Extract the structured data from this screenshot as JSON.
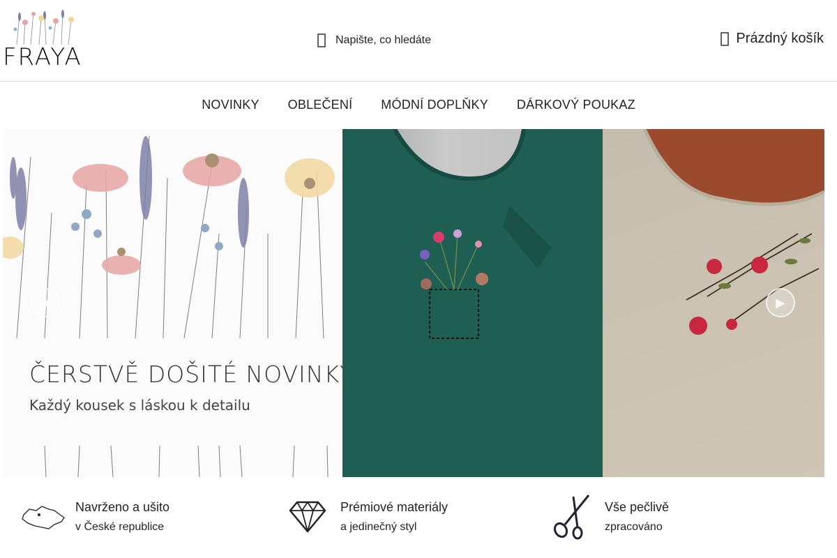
{
  "brand": {
    "logo_text": "FRAYA"
  },
  "header": {
    "search_label": "Napište, co hledáte",
    "cart_label": "Prázdný košík"
  },
  "nav": {
    "items": [
      {
        "label": "NOVINKY"
      },
      {
        "label": "OBLEČENÍ"
      },
      {
        "label": "MÓDNÍ DOPLŇKY"
      },
      {
        "label": "DÁRKOVÝ POUKAZ"
      }
    ]
  },
  "hero": {
    "title": "ČERSTVĚ DOŠITÉ NOVINKY",
    "subtitle": "Každý kousek s láskou k detailu",
    "prev_icon": "chevron-left-icon",
    "next_icon": "chevron-right-icon",
    "prev_glyph": "◀",
    "next_glyph": "▶"
  },
  "features": [
    {
      "icon": "czech-map-icon",
      "line1": "Navrženo a ušito",
      "line2": "v České republice"
    },
    {
      "icon": "diamond-icon",
      "line1": "Prémiové materiály",
      "line2": "a jedinečný styl"
    },
    {
      "icon": "scissors-icon",
      "line1": "Vše pečlivě",
      "line2": "zpracováno"
    }
  ]
}
